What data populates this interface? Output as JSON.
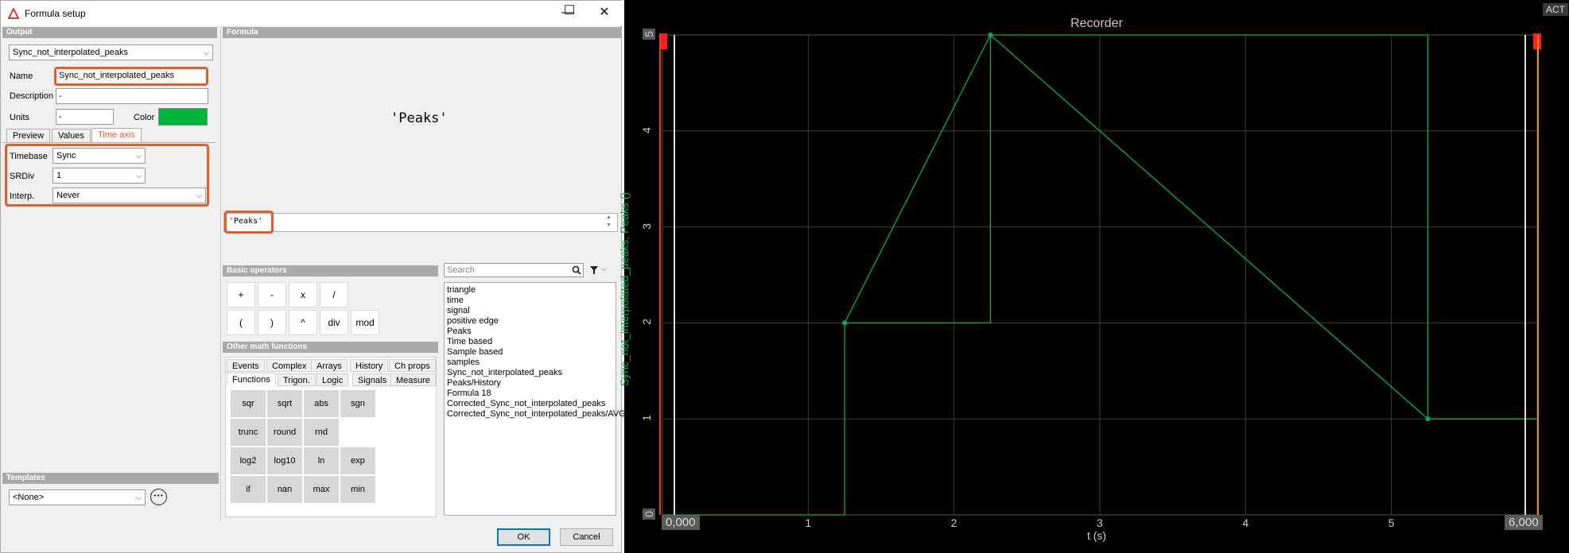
{
  "window": {
    "title": "Formula setup",
    "minimize": "—",
    "maximize": "☐",
    "close": "✕"
  },
  "output": {
    "header": "Output",
    "channel_select": "Sync_not_interpolated_peaks",
    "name_label": "Name",
    "name_value": "Sync_not_interpolated_peaks",
    "description_label": "Description",
    "description_value": "-",
    "units_label": "Units",
    "units_value": "-",
    "color_label": "Color",
    "color_value": "#00b33c"
  },
  "tabs": [
    {
      "label": "Preview",
      "active": false
    },
    {
      "label": "Values",
      "active": false
    },
    {
      "label": "Time axis",
      "active": true
    }
  ],
  "time_axis": {
    "timebase_label": "Timebase",
    "timebase_value": "Sync",
    "srdiv_label": "SRDiv",
    "srdiv_value": "1",
    "interp_label": "Interp.",
    "interp_value": "Never"
  },
  "templates": {
    "header": "Templates",
    "value": "<None>",
    "more": "···"
  },
  "formula": {
    "header": "Formula",
    "preview": "'Peaks'",
    "edit_value": "'Peaks'"
  },
  "basic_operators": {
    "header": "Basic operators",
    "row1": [
      "+",
      "-",
      "x",
      "/"
    ],
    "row2": [
      "(",
      ")",
      "^",
      "div",
      "mod"
    ]
  },
  "math": {
    "header": "Other math functions",
    "tabs_row1": [
      "Events",
      "Complex",
      "Arrays",
      "History",
      "Ch props"
    ],
    "tabs_row2": [
      "Functions",
      "Trigon.",
      "Logic",
      "Signals",
      "Measure"
    ],
    "functions": [
      [
        "sqr",
        "sqrt",
        "abs",
        "sgn"
      ],
      [
        "trunc",
        "round",
        "rnd"
      ],
      [
        "log2",
        "log10",
        "ln",
        "exp"
      ],
      [
        "if",
        "nan",
        "max",
        "min"
      ]
    ]
  },
  "search": {
    "placeholder": "Search"
  },
  "channels": [
    "triangle",
    "time",
    "signal",
    "positive edge",
    "Peaks",
    "Time based",
    "Sample based",
    "samples",
    "Sync_not_interpolated_peaks",
    "Peaks/History",
    "Formula 18",
    "Corrected_Sync_not_interpolated_peaks",
    "Corrected_Sync_not_interpolated_peaks/AVG"
  ],
  "buttons": {
    "ok": "OK",
    "cancel": "Cancel"
  },
  "recorder": {
    "title": "Recorder",
    "badge": "ACT",
    "x_start": "0,000",
    "x_end": "6,000",
    "xlabel": "t (s)",
    "ylabel": "Sync_not_interpolated_peaks, Peaks ()",
    "x_ticks": [
      "1",
      "2",
      "3",
      "4",
      "5"
    ],
    "y_ticks": [
      "0",
      "1",
      "2",
      "3",
      "4",
      "5"
    ],
    "trace_color": "#00b050"
  },
  "chart_data": {
    "type": "line",
    "title": "Recorder",
    "xlabel": "t (s)",
    "ylabel": "Sync_not_interpolated_peaks, Peaks ()",
    "xlim": [
      0,
      6
    ],
    "ylim": [
      0,
      5
    ],
    "grid": true,
    "series": [
      {
        "name": "Sync_not_interpolated_peaks",
        "style": "step",
        "x": [
          0,
          1.25,
          1.25,
          2.25,
          2.25,
          5.25,
          5.25,
          6
        ],
        "y": [
          0,
          0,
          2,
          2,
          5,
          5,
          1,
          1
        ]
      },
      {
        "name": "Peaks",
        "style": "line-markers",
        "x": [
          1.25,
          2.25,
          5.25,
          6
        ],
        "y": [
          2,
          5,
          1,
          1
        ]
      }
    ]
  }
}
